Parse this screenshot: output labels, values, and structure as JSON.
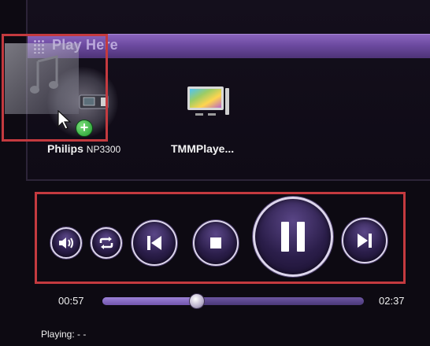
{
  "panel": {
    "title": "Play Here"
  },
  "devices": [
    {
      "name": "Philips",
      "model": "NP3300"
    },
    {
      "name": "TMMPlaye..."
    }
  ],
  "transport": {
    "buttons": [
      "volume",
      "repeat",
      "previous",
      "stop",
      "pause",
      "next"
    ]
  },
  "seek": {
    "elapsed": "00:57",
    "total": "02:37",
    "progress": 0.36
  },
  "status": {
    "label": "Playing:",
    "value": "- -"
  },
  "colors": {
    "accent": "#6c4aa0",
    "highlight": "#c43a3f",
    "button_border": "#ddd6ec"
  }
}
